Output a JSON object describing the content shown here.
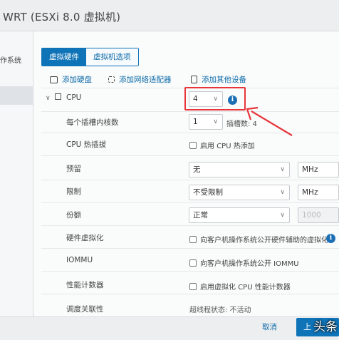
{
  "window": {
    "title": "WRT (ESXi 8.0 虚拟机)"
  },
  "leftnav": {
    "item1": "作系统"
  },
  "tabs": [
    {
      "label": "虚拟硬件"
    },
    {
      "label": "虚拟机选项"
    }
  ],
  "toolbar": {
    "add_disk": "添加硬盘",
    "add_nic": "添加网络适配器",
    "add_other": "添加其他设备"
  },
  "cpu": {
    "label": "CPU",
    "value": "4",
    "cores_label": "每个插槽内核数",
    "cores_value": "1",
    "sockets_text": "插槽数: 4",
    "hotplug_label": "CPU 热插拔",
    "hotplug_text": "启用 CPU 热添加",
    "reservation_label": "预留",
    "reservation_value": "无",
    "reservation_unit": "MHz",
    "limit_label": "限制",
    "limit_value": "不受限制",
    "limit_unit": "MHz",
    "shares_label": "份额",
    "shares_value": "正常",
    "shares_number": "1000",
    "hv_label": "硬件虚拟化",
    "hv_text": "向客户机操作系统公开硬件辅助的虚拟化",
    "iommu_label": "IOMMU",
    "iommu_text": "向客户机操作系统公开 IOMMU",
    "perf_label": "性能计数器",
    "perf_text": "启用虚拟化 CPU 性能计数器",
    "sched_label": "调度关联性",
    "sched_text": "超线程状态: 不活动"
  },
  "footer": {
    "cancel": "取消",
    "ok": "上",
    "watermark": "头条"
  },
  "colors": {
    "accent": "#0f73b7",
    "annotation": "#e8353a"
  }
}
